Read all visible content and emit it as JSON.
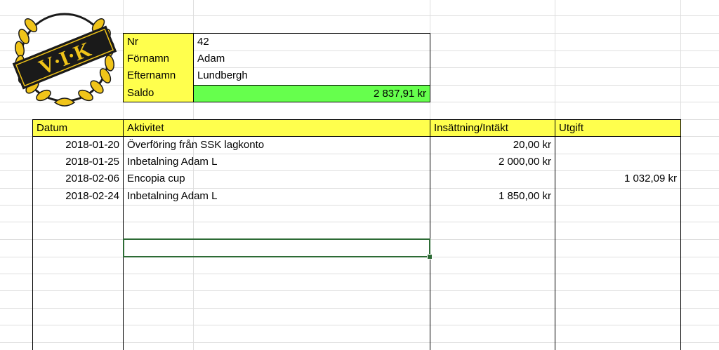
{
  "logo": {
    "text": "V·I·K"
  },
  "info": [
    {
      "label": "Nr",
      "value": "42"
    },
    {
      "label": "Förnamn",
      "value": "Adam"
    },
    {
      "label": "Efternamn",
      "value": "Lundbergh"
    },
    {
      "label": "Saldo",
      "value": "2 837,91 kr"
    }
  ],
  "table": {
    "headers": [
      "Datum",
      "Aktivitet",
      "Insättning/Intäkt",
      "Utgift"
    ],
    "rows": [
      {
        "date": "2018-01-20",
        "activity": "Överföring från SSK lagkonto",
        "income": "20,00 kr",
        "expense": ""
      },
      {
        "date": "2018-01-25",
        "activity": "Inbetalning Adam L",
        "income": "2 000,00 kr",
        "expense": ""
      },
      {
        "date": "2018-02-06",
        "activity": "Encopia cup",
        "income": "",
        "expense": "1 032,09 kr"
      },
      {
        "date": "2018-02-24",
        "activity": "Inbetalning Adam L",
        "income": "1 850,00 kr",
        "expense": ""
      }
    ]
  },
  "colors": {
    "header_yellow": "#ffff4d",
    "saldo_green": "#66ff4d",
    "selection": "#2d6b35"
  }
}
